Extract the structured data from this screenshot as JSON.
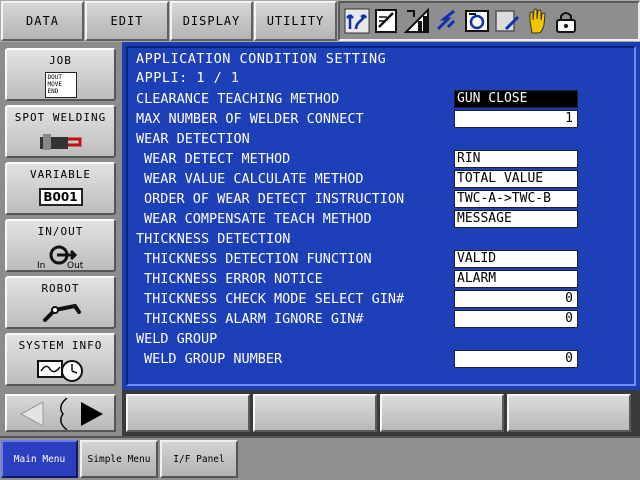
{
  "top_menu": [
    "DATA",
    "EDIT",
    "DISPLAY",
    "UTILITY"
  ],
  "status_icons": [
    "coordinate-system-icon",
    "teach-mode-icon",
    "speed-level-icon",
    "servo-status-icon",
    "cycle-mode-icon",
    "job-edit-icon",
    "manual-hold-icon",
    "security-level-icon"
  ],
  "sidebar": {
    "items": [
      {
        "label": "JOB",
        "icon_lines": [
          "DOUT",
          "MOVE",
          "END"
        ]
      },
      {
        "label": "SPOT WELDING"
      },
      {
        "label": "VARIABLE",
        "badge": "B001"
      },
      {
        "label": "IN/OUT",
        "in_label": "In",
        "out_label": "Out"
      },
      {
        "label": "ROBOT"
      },
      {
        "label": "SYSTEM INFO"
      }
    ]
  },
  "screen": {
    "title": "APPLICATION CONDITION SETTING",
    "subtitle": "APPLI: 1 / 1",
    "rows": [
      {
        "label": "CLEARANCE TEACHING METHOD",
        "value": "GUN CLOSE",
        "kind": "text",
        "selected": true,
        "indent": false
      },
      {
        "label": "MAX NUMBER OF WELDER CONNECT",
        "value": "1",
        "kind": "num",
        "indent": false
      },
      {
        "label": "WEAR DETECTION",
        "kind": "header",
        "indent": false
      },
      {
        "label": "WEAR DETECT METHOD",
        "value": "RIN",
        "kind": "text",
        "indent": true
      },
      {
        "label": "WEAR VALUE CALCULATE METHOD",
        "value": "TOTAL VALUE",
        "kind": "text",
        "indent": true
      },
      {
        "label": "ORDER OF WEAR DETECT INSTRUCTION",
        "value": "TWC-A->TWC-B",
        "kind": "text",
        "indent": true
      },
      {
        "label": "WEAR COMPENSATE TEACH METHOD",
        "value": "MESSAGE",
        "kind": "text",
        "indent": true
      },
      {
        "label": "THICKNESS DETECTION",
        "kind": "header",
        "indent": false
      },
      {
        "label": "THICKNESS DETECTION FUNCTION",
        "value": "VALID",
        "kind": "text",
        "indent": true
      },
      {
        "label": "THICKNESS ERROR NOTICE",
        "value": "ALARM",
        "kind": "text",
        "indent": true
      },
      {
        "label": "THICKNESS CHECK MODE SELECT GIN#",
        "value": "0",
        "kind": "num",
        "indent": true
      },
      {
        "label": "THICKNESS ALARM IGNORE GIN#",
        "value": "0",
        "kind": "num",
        "indent": true
      },
      {
        "label": "WELD GROUP",
        "kind": "header",
        "indent": false
      },
      {
        "label": "WELD GROUP NUMBER",
        "value": "0",
        "kind": "num",
        "indent": true
      }
    ]
  },
  "bottom_tabs": [
    "Main Menu",
    "Simple Menu",
    "I/F Panel"
  ],
  "colors": {
    "screen_bg": "#1d3fb8",
    "active_tab": "#2b3fbf",
    "selected_field": "#000000"
  }
}
